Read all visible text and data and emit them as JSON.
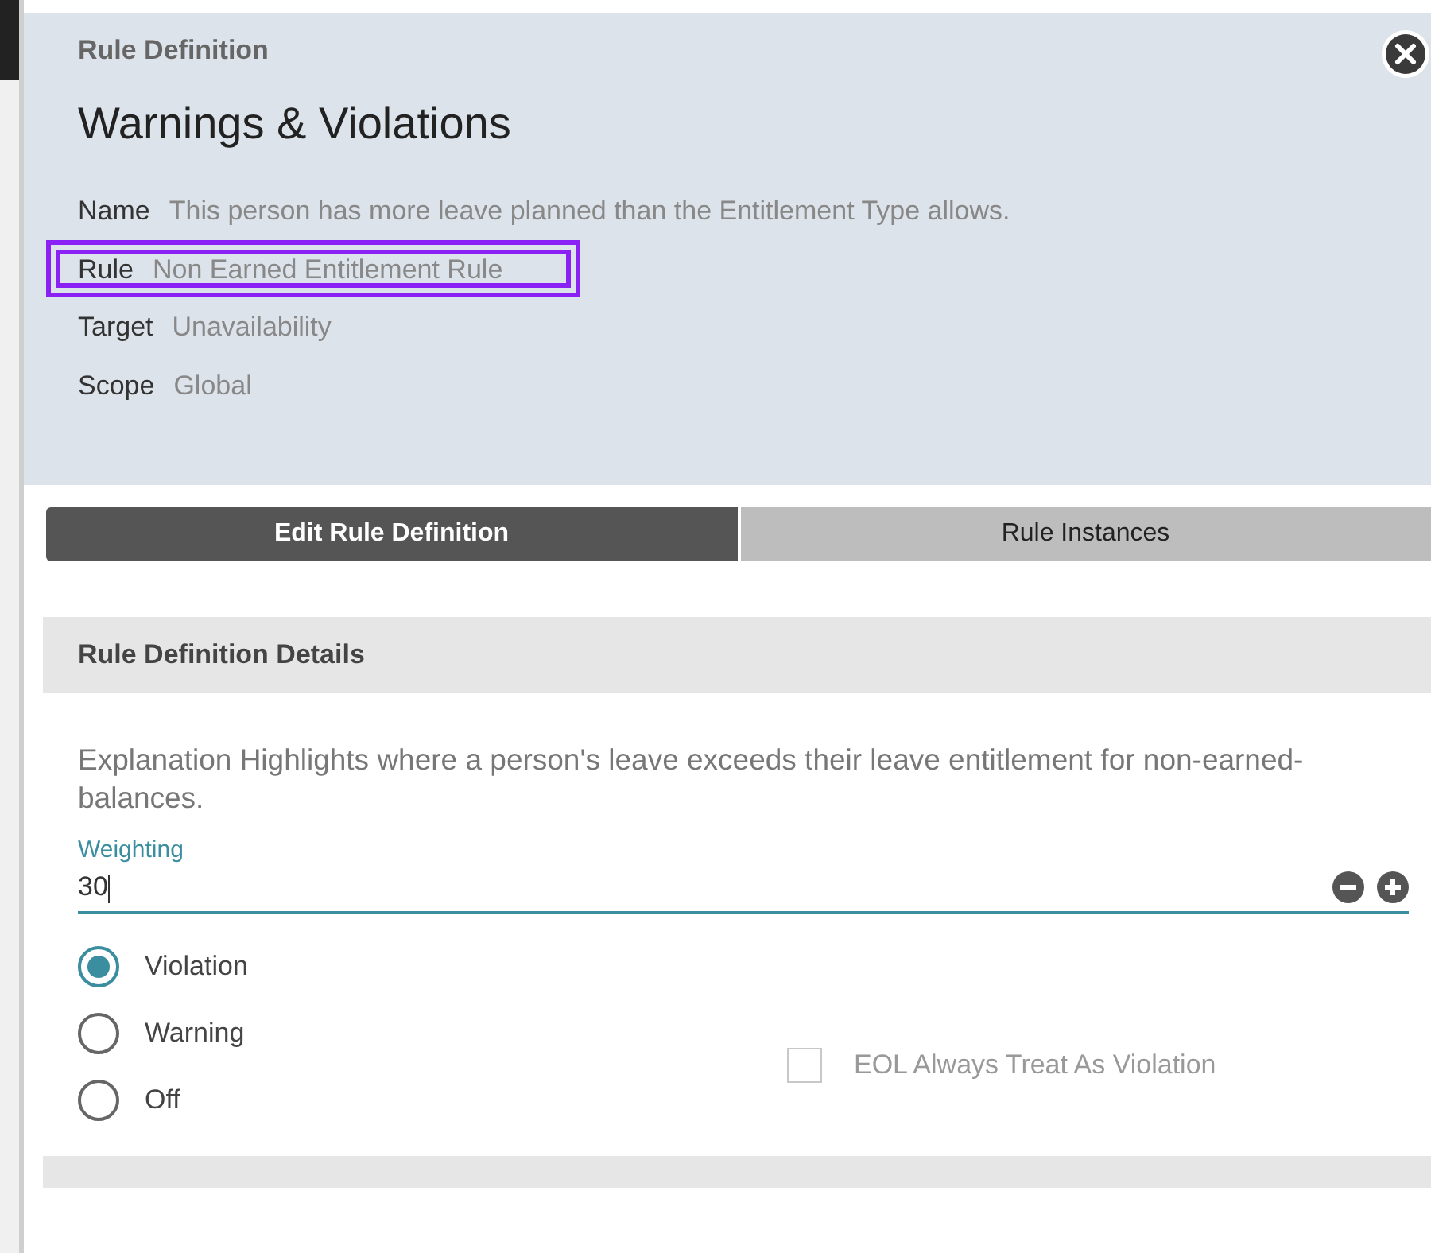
{
  "header": {
    "subtitle": "Rule Definition",
    "title": "Warnings & Violations",
    "details": [
      {
        "label": "Name",
        "value": "This person has more leave planned than the Entitlement Type allows.",
        "highlighted": false
      },
      {
        "label": "Rule",
        "value": "Non Earned Entitlement Rule",
        "highlighted": true
      },
      {
        "label": "Target",
        "value": "Unavailability",
        "highlighted": false
      },
      {
        "label": "Scope",
        "value": "Global",
        "highlighted": false
      }
    ]
  },
  "tabs": [
    {
      "label": "Edit Rule Definition",
      "selected": true
    },
    {
      "label": "Rule Instances",
      "selected": false
    }
  ],
  "section": {
    "title": "Rule Definition Details",
    "explanation": "Explanation Highlights where a person's leave exceeds their leave entitlement for non-earned-balances.",
    "weighting": {
      "label": "Weighting",
      "value": "30"
    },
    "severity": [
      {
        "label": "Violation",
        "selected": true
      },
      {
        "label": "Warning",
        "selected": false
      },
      {
        "label": "Off",
        "selected": false
      }
    ],
    "eol": {
      "label": "EOL Always Treat As Violation",
      "checked": false,
      "disabled": true
    }
  }
}
